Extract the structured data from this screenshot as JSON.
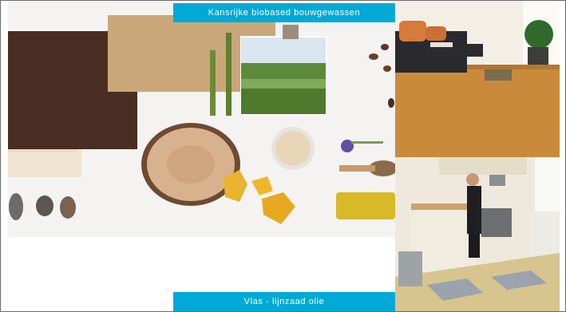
{
  "banners": {
    "top": "Kansrijke biobased bouwgewassen",
    "bottom": "Vlas - lijnzaad olie"
  },
  "images": {
    "main": "materials-collage",
    "top_right": "living-room-cork-floor",
    "bottom_right": "kitchen-linoleum-floor"
  },
  "colors": {
    "banner_bg": "#00a9d6",
    "banner_text": "#ffffff",
    "frame_border": "#6b6b6b"
  }
}
